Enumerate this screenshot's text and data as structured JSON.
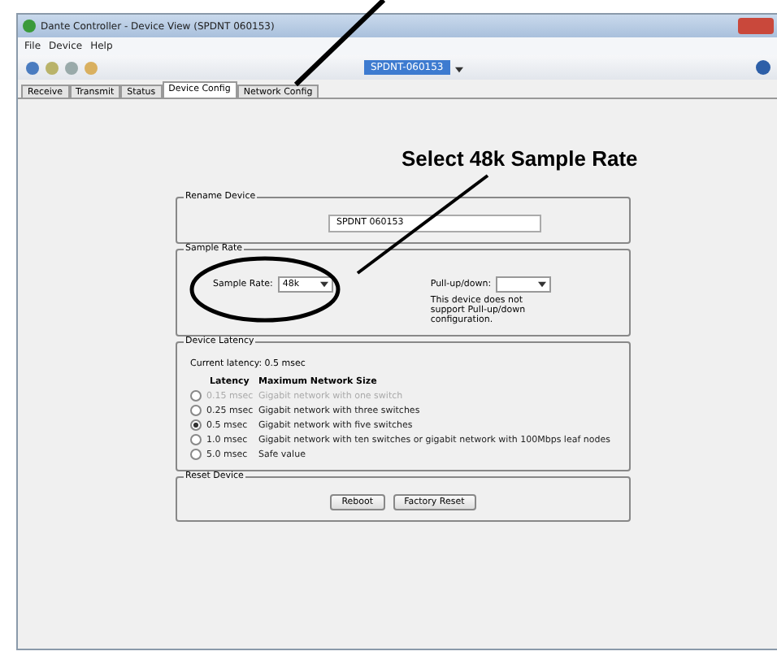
{
  "window": {
    "title": "Dante Controller - Device View (SPDNT 060153)"
  },
  "menu": [
    {
      "label": "File"
    },
    {
      "label": "Device"
    },
    {
      "label": "Help"
    }
  ],
  "toolbar": {
    "device_selector": "SPDNT-060153"
  },
  "tabs": [
    {
      "label": "Receive",
      "selected": false
    },
    {
      "label": "Transmit",
      "selected": false
    },
    {
      "label": "Status",
      "selected": false
    },
    {
      "label": "Device Config",
      "selected": true
    },
    {
      "label": "Network Config",
      "selected": false
    }
  ],
  "rename_device": {
    "legend": "Rename Device",
    "value": "SPDNT 060153"
  },
  "sample_rate": {
    "legend": "Sample Rate",
    "label": "Sample Rate:",
    "value": "48k",
    "pullup_label": "Pull-up/down:",
    "pullup_note": "This device does not support Pull-up/down configuration."
  },
  "device_latency": {
    "legend": "Device Latency",
    "current": "Current latency: 0.5 msec",
    "columns": [
      "Latency",
      "Maximum Network Size"
    ],
    "rows": [
      {
        "latency": "0.15 msec",
        "network": "Gigabit network with one switch",
        "selected": false,
        "disabled": true
      },
      {
        "latency": "0.25 msec",
        "network": "Gigabit network with three switches",
        "selected": false,
        "disabled": false
      },
      {
        "latency": "0.5 msec",
        "network": "Gigabit network with five switches",
        "selected": true,
        "disabled": false
      },
      {
        "latency": "1.0 msec",
        "network": "Gigabit network with ten switches or gigabit network with 100Mbps leaf nodes",
        "selected": false,
        "disabled": false
      },
      {
        "latency": "5.0 msec",
        "network": "Safe value",
        "selected": false,
        "disabled": false
      }
    ]
  },
  "reset_device": {
    "legend": "Reset Device",
    "buttons": [
      {
        "label": "Reboot"
      },
      {
        "label": "Factory Reset"
      }
    ]
  },
  "annotation": {
    "text": "Select 48k Sample Rate"
  }
}
